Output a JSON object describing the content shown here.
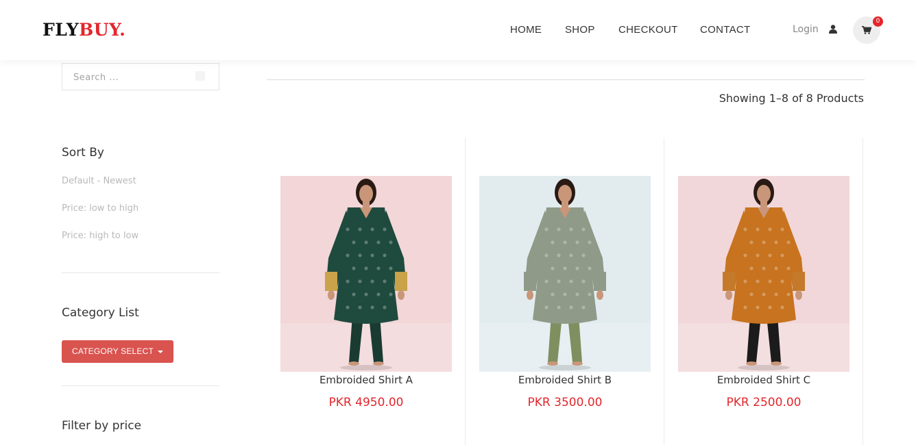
{
  "header": {
    "logo_main": "FLY",
    "logo_accent": "BUY.",
    "nav": [
      "HOME",
      "SHOP",
      "CHECKOUT",
      "CONTACT"
    ],
    "login": "Login",
    "cart_count": "0",
    "accent_color": "#e3262c"
  },
  "sidebar": {
    "search_placeholder": "Search ...",
    "sort_title": "Sort By",
    "sort_options": [
      "Default - Newest",
      "Price: low to high",
      "Price: high to low"
    ],
    "category_title": "Category List",
    "category_button": "CATEGORY SELECT",
    "filter_title": "Filter by price"
  },
  "main": {
    "result_count": "Showing 1–8 of 8 Products",
    "products": [
      {
        "name": "Embroided Shirt A",
        "price": "PKR 4950.00",
        "bg": "#f2d6d8",
        "garment": "#1f4a3e",
        "pants": "#1a3b32",
        "sleeve": "#c9a24a"
      },
      {
        "name": "Embroided Shirt B",
        "price": "PKR 3500.00",
        "bg": "#e2ecef",
        "garment": "#8f9a88",
        "pants": "#7f8f5f",
        "sleeve": "#8f9a88"
      },
      {
        "name": "Embroided Shirt C",
        "price": "PKR 2500.00",
        "bg": "#f1d7d9",
        "garment": "#c7731f",
        "pants": "#1b1b1b",
        "sleeve": "#c47a2a"
      }
    ]
  }
}
